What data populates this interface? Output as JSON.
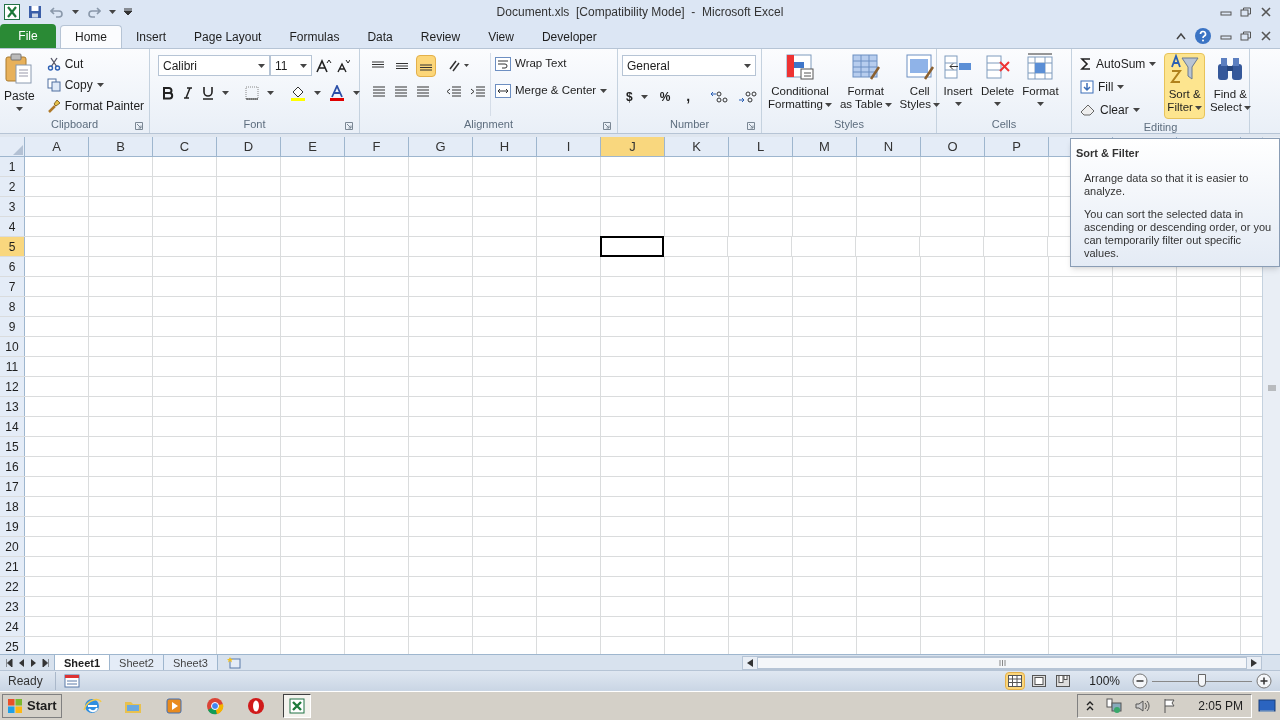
{
  "window": {
    "title": "Document.xls  [Compatibility Mode]  -  Microsoft Excel"
  },
  "ribbon_tabs": [
    {
      "label": "File",
      "kind": "file",
      "selected": false
    },
    {
      "label": "Home",
      "kind": "tab",
      "selected": true
    },
    {
      "label": "Insert",
      "kind": "tab",
      "selected": false
    },
    {
      "label": "Page Layout",
      "kind": "tab",
      "selected": false
    },
    {
      "label": "Formulas",
      "kind": "tab",
      "selected": false
    },
    {
      "label": "Data",
      "kind": "tab",
      "selected": false
    },
    {
      "label": "Review",
      "kind": "tab",
      "selected": false
    },
    {
      "label": "View",
      "kind": "tab",
      "selected": false
    },
    {
      "label": "Developer",
      "kind": "tab",
      "selected": false
    }
  ],
  "clipboard": {
    "label": "Clipboard",
    "paste": "Paste",
    "cut": "Cut",
    "copy": "Copy",
    "format_painter": "Format Painter"
  },
  "font": {
    "label": "Font",
    "name": "Calibri",
    "size": "11"
  },
  "alignment": {
    "label": "Alignment",
    "wrap_text": "Wrap Text",
    "merge": "Merge & Center",
    "vertical_buttons": [
      {
        "kind": "top",
        "selected": false
      },
      {
        "kind": "middle",
        "selected": false
      },
      {
        "kind": "bottom",
        "selected": true
      }
    ]
  },
  "number": {
    "label": "Number",
    "format": "General",
    "currency": "$",
    "percent": "%",
    "comma": ","
  },
  "styles": {
    "label": "Styles",
    "buttons": [
      {
        "kind": "conditional",
        "lines": [
          "Conditional",
          "Formatting"
        ]
      },
      {
        "kind": "table",
        "lines": [
          "Format",
          "as Table"
        ]
      },
      {
        "kind": "cell",
        "lines": [
          "Cell",
          "Styles"
        ]
      }
    ]
  },
  "cells": {
    "label": "Cells",
    "buttons": [
      {
        "kind": "insert",
        "label": "Insert"
      },
      {
        "kind": "delete",
        "label": "Delete"
      },
      {
        "kind": "format",
        "label": "Format"
      }
    ]
  },
  "editing": {
    "label": "Editing",
    "autosum": "AutoSum",
    "fill": "Fill",
    "clear": "Clear",
    "sort": {
      "lines": [
        "Sort &",
        "Filter"
      ],
      "highlighted": true
    },
    "find": {
      "lines": [
        "Find &",
        "Select"
      ]
    }
  },
  "tooltip": {
    "title": "Sort & Filter",
    "paragraphs": [
      "Arrange data so that it is easier to analyze.",
      "You can sort the selected data in ascending or descending order, or you can temporarily filter out specific values."
    ]
  },
  "sheet": {
    "columns": [
      {
        "label": "A",
        "selected": false
      },
      {
        "label": "B",
        "selected": false
      },
      {
        "label": "C",
        "selected": false
      },
      {
        "label": "D",
        "selected": false
      },
      {
        "label": "E",
        "selected": false
      },
      {
        "label": "F",
        "selected": false
      },
      {
        "label": "G",
        "selected": false
      },
      {
        "label": "H",
        "selected": false
      },
      {
        "label": "I",
        "selected": false
      },
      {
        "label": "J",
        "selected": true
      },
      {
        "label": "K",
        "selected": false
      },
      {
        "label": "L",
        "selected": false
      },
      {
        "label": "M",
        "selected": false
      },
      {
        "label": "N",
        "selected": false
      },
      {
        "label": "O",
        "selected": false
      },
      {
        "label": "P",
        "selected": false
      }
    ],
    "rows": [
      {
        "label": "1",
        "selected": false
      },
      {
        "label": "2",
        "selected": false
      },
      {
        "label": "3",
        "selected": false
      },
      {
        "label": "4",
        "selected": false
      },
      {
        "label": "5",
        "selected": true
      },
      {
        "label": "6",
        "selected": false
      },
      {
        "label": "7",
        "selected": false
      },
      {
        "label": "8",
        "selected": false
      },
      {
        "label": "9",
        "selected": false
      },
      {
        "label": "10",
        "selected": false
      },
      {
        "label": "11",
        "selected": false
      },
      {
        "label": "12",
        "selected": false
      },
      {
        "label": "13",
        "selected": false
      },
      {
        "label": "14",
        "selected": false
      },
      {
        "label": "15",
        "selected": false
      },
      {
        "label": "16",
        "selected": false
      },
      {
        "label": "17",
        "selected": false
      },
      {
        "label": "18",
        "selected": false
      },
      {
        "label": "19",
        "selected": false
      },
      {
        "label": "20",
        "selected": false
      },
      {
        "label": "21",
        "selected": false
      },
      {
        "label": "22",
        "selected": false
      },
      {
        "label": "23",
        "selected": false
      },
      {
        "label": "24",
        "selected": false
      },
      {
        "label": "25",
        "selected": false
      }
    ]
  },
  "sheet_tabs": [
    {
      "label": "Sheet1",
      "selected": true
    },
    {
      "label": "Sheet2",
      "selected": false
    },
    {
      "label": "Sheet3",
      "selected": false
    }
  ],
  "status_bar": {
    "status": "Ready",
    "view_buttons": [
      {
        "kind": "normal",
        "selected": true
      },
      {
        "kind": "page_layout",
        "selected": false
      },
      {
        "kind": "page_break",
        "selected": false
      }
    ],
    "zoom": "100%",
    "zoom_slider": {
      "level": 0.5
    }
  },
  "taskbar": {
    "start": "Start",
    "apps": [
      {
        "kind": "browser",
        "selected": false
      },
      {
        "kind": "folder",
        "selected": false
      },
      {
        "kind": "player",
        "selected": false
      },
      {
        "kind": "chrome",
        "selected": false
      },
      {
        "kind": "opera",
        "selected": false
      },
      {
        "kind": "excel",
        "selected": true
      }
    ],
    "clock": "2:05 PM"
  }
}
